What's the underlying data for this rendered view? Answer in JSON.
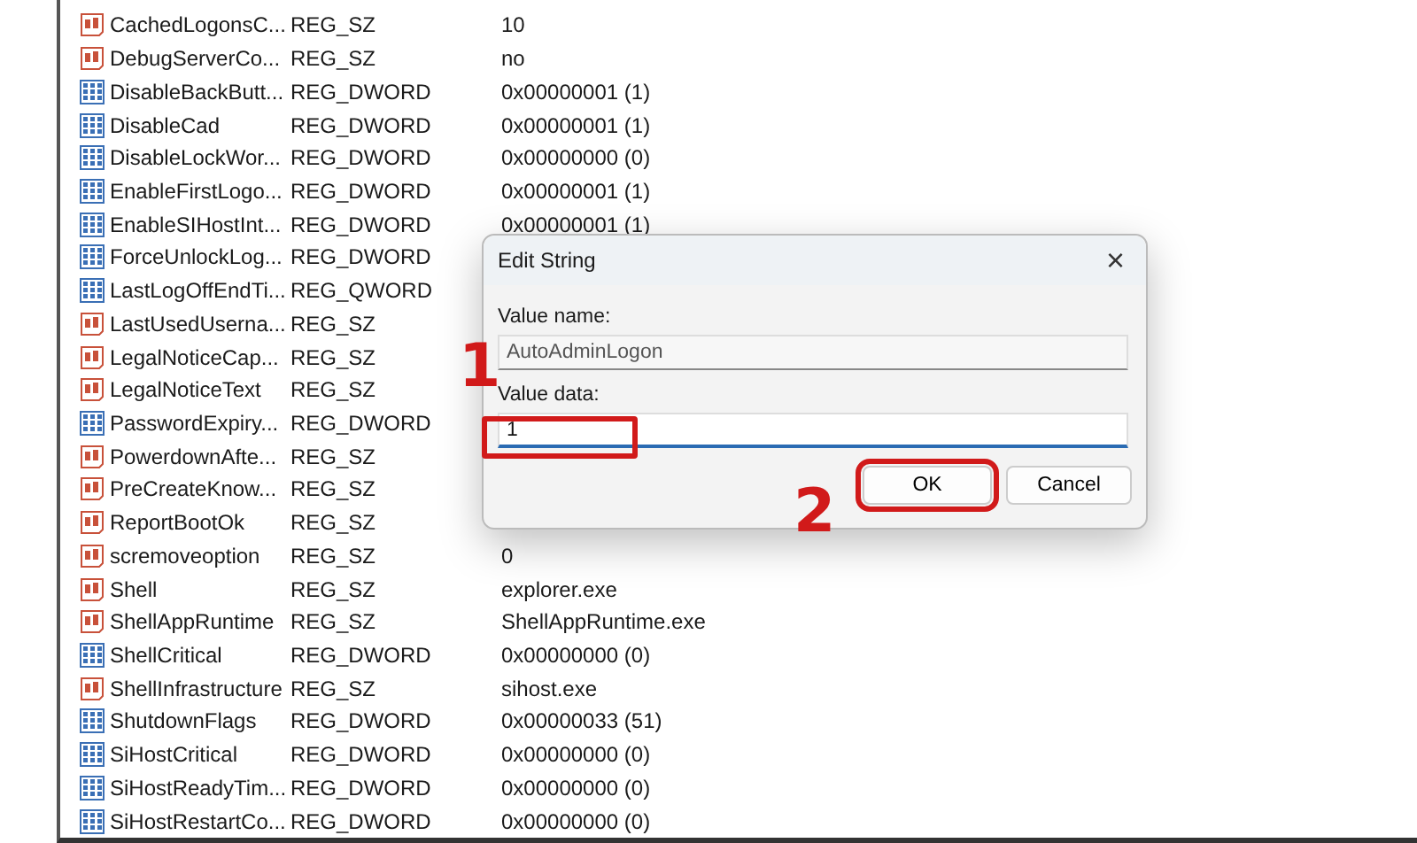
{
  "values": [
    {
      "name": "CachedLogonsC...",
      "kind": "string",
      "type": "REG_SZ",
      "data": "10"
    },
    {
      "name": "DebugServerCo...",
      "kind": "string",
      "type": "REG_SZ",
      "data": "no"
    },
    {
      "name": "DisableBackButt...",
      "kind": "binary",
      "type": "REG_DWORD",
      "data": "0x00000001 (1)"
    },
    {
      "name": "DisableCad",
      "kind": "binary",
      "type": "REG_DWORD",
      "data": "0x00000001 (1)"
    },
    {
      "name": "DisableLockWor...",
      "kind": "binary",
      "type": "REG_DWORD",
      "data": "0x00000000 (0)"
    },
    {
      "name": "EnableFirstLogo...",
      "kind": "binary",
      "type": "REG_DWORD",
      "data": "0x00000001 (1)"
    },
    {
      "name": "EnableSIHostInt...",
      "kind": "binary",
      "type": "REG_DWORD",
      "data": "0x00000001 (1)"
    },
    {
      "name": "ForceUnlockLog...",
      "kind": "binary",
      "type": "REG_DWORD"
    },
    {
      "name": "LastLogOffEndTi...",
      "kind": "binary",
      "type": "REG_QWORD"
    },
    {
      "name": "LastUsedUserna...",
      "kind": "string",
      "type": "REG_SZ"
    },
    {
      "name": "LegalNoticeCap...",
      "kind": "string",
      "type": "REG_SZ"
    },
    {
      "name": "LegalNoticeText",
      "kind": "string",
      "type": "REG_SZ"
    },
    {
      "name": "PasswordExpiry...",
      "kind": "binary",
      "type": "REG_DWORD"
    },
    {
      "name": "PowerdownAfte...",
      "kind": "string",
      "type": "REG_SZ"
    },
    {
      "name": "PreCreateKnow...",
      "kind": "string",
      "type": "REG_SZ"
    },
    {
      "name": "ReportBootOk",
      "kind": "string",
      "type": "REG_SZ"
    },
    {
      "name": "scremoveoption",
      "kind": "string",
      "type": "REG_SZ",
      "data": "0"
    },
    {
      "name": "Shell",
      "kind": "string",
      "type": "REG_SZ",
      "data": "explorer.exe"
    },
    {
      "name": "ShellAppRuntime",
      "kind": "string",
      "type": "REG_SZ",
      "data": "ShellAppRuntime.exe"
    },
    {
      "name": "ShellCritical",
      "kind": "binary",
      "type": "REG_DWORD",
      "data": "0x00000000 (0)"
    },
    {
      "name": "ShellInfrastructure",
      "kind": "string",
      "type": "REG_SZ",
      "data": "sihost.exe"
    },
    {
      "name": "ShutdownFlags",
      "kind": "binary",
      "type": "REG_DWORD",
      "data": "0x00000033 (51)"
    },
    {
      "name": "SiHostCritical",
      "kind": "binary",
      "type": "REG_DWORD",
      "data": "0x00000000 (0)"
    },
    {
      "name": "SiHostReadyTim...",
      "kind": "binary",
      "type": "REG_DWORD",
      "data": "0x00000000 (0)"
    },
    {
      "name": "SiHostRestartCo...",
      "kind": "binary",
      "type": "REG_DWORD",
      "data": "0x00000000 (0)"
    }
  ],
  "dialog": {
    "title": "Edit String",
    "close": "×",
    "name_label": "Value name:",
    "name_value": "AutoAdminLogon",
    "data_label": "Value data:",
    "data_value": "1",
    "buttons": [
      "OK",
      "Cancel"
    ]
  },
  "annotations": [
    "1",
    "2"
  ]
}
